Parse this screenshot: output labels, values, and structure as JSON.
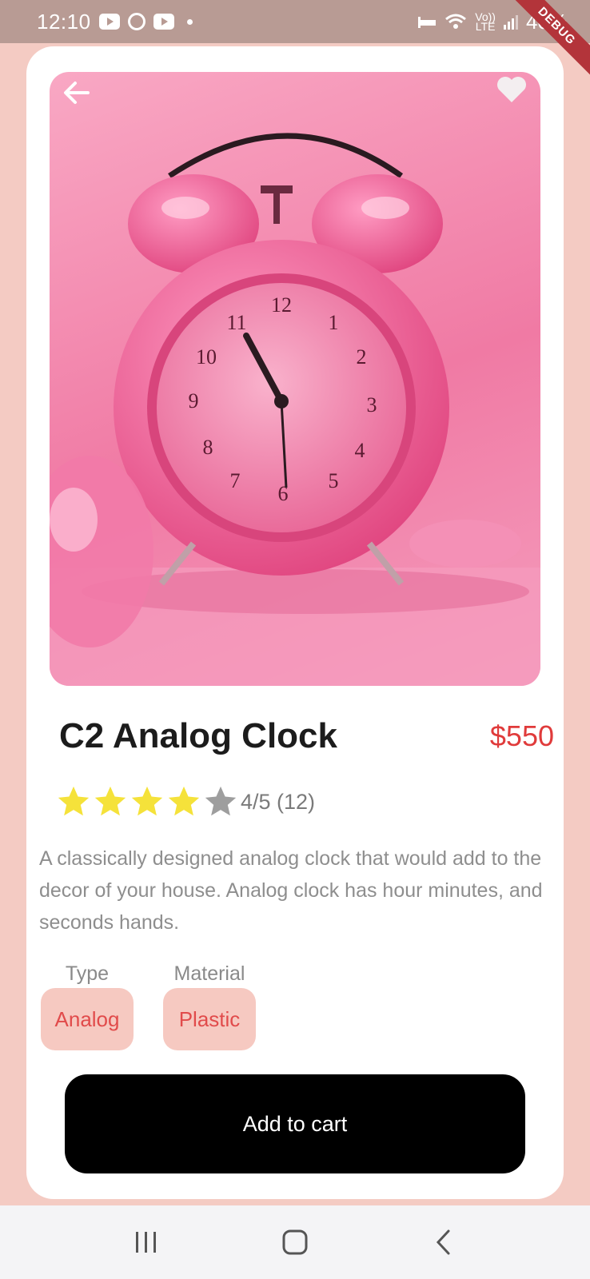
{
  "status_bar": {
    "time": "12:10",
    "battery": "40%",
    "network": "LTE",
    "volte": "Vo))"
  },
  "debug_banner": "DEBUG",
  "product": {
    "title": "C2 Analog Clock",
    "price": "$550",
    "rating": {
      "filled_stars": 4,
      "total_stars": 5,
      "text": "4/5 (12)"
    },
    "description": "A classically designed analog clock that would add to the decor of your house. Analog clock has hour minutes, and seconds hands.",
    "attributes": [
      {
        "label": "Type",
        "value": "Analog"
      },
      {
        "label": "Material",
        "value": "Plastic"
      }
    ],
    "image": {
      "subject": "pink alarm clock on pink background"
    }
  },
  "actions": {
    "add_to_cart_label": "Add to cart"
  },
  "icons": {
    "back": "arrow-left-icon",
    "favorite": "heart-icon",
    "star": "star-icon",
    "nav_recents": "recents-icon",
    "nav_home": "home-icon",
    "nav_back": "chevron-left-icon"
  },
  "colors": {
    "background": "#f4cbc3",
    "price": "#e03b3b",
    "star_filled": "#f5e23a",
    "star_empty": "#9e9e9e",
    "chip_bg": "#f6c9c1",
    "chip_text": "#e14b4b",
    "button_bg": "#000000"
  }
}
